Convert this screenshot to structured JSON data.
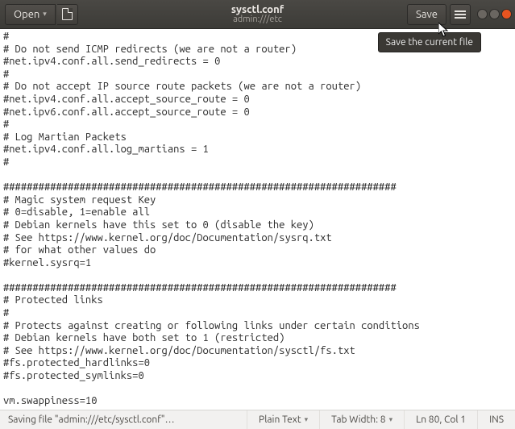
{
  "header": {
    "open_label": "Open",
    "title": "sysctl.conf",
    "subtitle": "admin:///etc",
    "save_label": "Save",
    "tooltip": "Save the current file"
  },
  "editor": {
    "content": "#\n# Do not send ICMP redirects (we are not a router)\n#net.ipv4.conf.all.send_redirects = 0\n#\n# Do not accept IP source route packets (we are not a router)\n#net.ipv4.conf.all.accept_source_route = 0\n#net.ipv6.conf.all.accept_source_route = 0\n#\n# Log Martian Packets\n#net.ipv4.conf.all.log_martians = 1\n#\n\n###################################################################\n# Magic system request Key\n# 0=disable, 1=enable all\n# Debian kernels have this set to 0 (disable the key)\n# See https://www.kernel.org/doc/Documentation/sysrq.txt\n# for what other values do\n#kernel.sysrq=1\n\n###################################################################\n# Protected links\n#\n# Protects against creating or following links under certain conditions\n# Debian kernels have both set to 1 (restricted)\n# See https://www.kernel.org/doc/Documentation/sysctl/fs.txt\n#fs.protected_hardlinks=0\n#fs.protected_symlinks=0\n\nvm.swappiness=10"
  },
  "statusbar": {
    "message": "Saving file \"admin:///etc/sysctl.conf\"…",
    "language": "Plain Text",
    "tab_width": "Tab Width: 8",
    "cursor": "Ln 80, Col 1",
    "insert_mode": "INS"
  }
}
